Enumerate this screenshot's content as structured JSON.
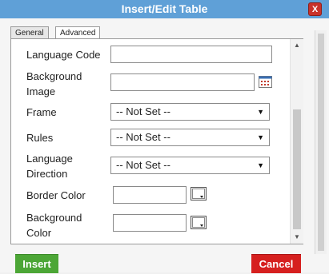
{
  "window": {
    "title": "Insert/Edit Table",
    "close_label": "X"
  },
  "tabs": [
    {
      "label": "General",
      "active": false
    },
    {
      "label": "Advanced",
      "active": true
    }
  ],
  "form": {
    "language_code": {
      "label": "Language Code",
      "value": ""
    },
    "background_image": {
      "label_line1": "Background",
      "label_line2": "Image",
      "value": "",
      "icon": "browse-icon"
    },
    "frame": {
      "label": "Frame",
      "selected": "-- Not Set --"
    },
    "rules": {
      "label": "Rules",
      "selected": "-- Not Set --"
    },
    "language_direction": {
      "label_line1": "Language",
      "label_line2": "Direction",
      "selected": "-- Not Set --"
    },
    "border_color": {
      "label": "Border Color",
      "value": "",
      "icon": "color-picker-icon"
    },
    "background_color": {
      "label_line1": "Background",
      "label_line2": "Color",
      "value": "",
      "icon": "color-picker-icon"
    }
  },
  "buttons": {
    "insert": "Insert",
    "cancel": "Cancel"
  },
  "colors": {
    "titlebar": "#5fa0d7",
    "insert": "#4ca636",
    "cancel": "#d6201f",
    "close": "#c8322b"
  }
}
